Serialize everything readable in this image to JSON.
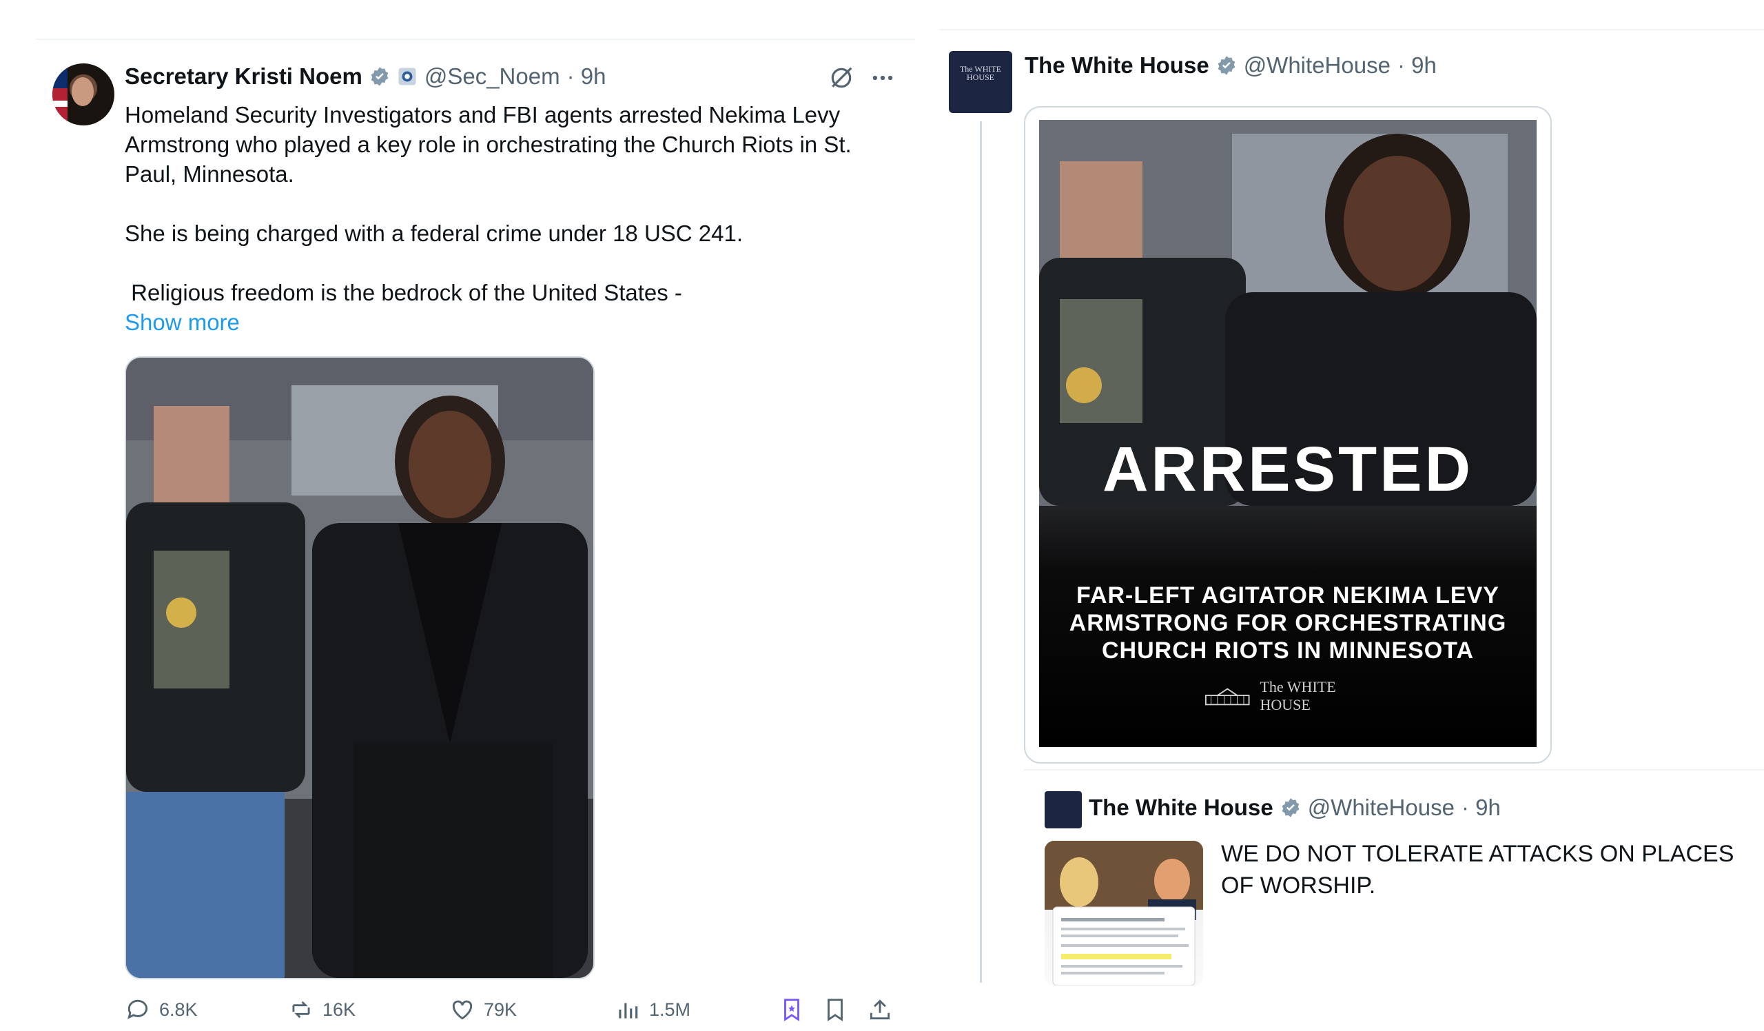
{
  "left_tweet": {
    "author_name": "Secretary Kristi Noem",
    "handle": "@Sec_Noem",
    "time": "· 9h",
    "paragraphs": [
      "Homeland Security Investigators and FBI agents arrested Nekima Levy Armstrong who played a key role in orchestrating the Church Riots in St. Paul, Minnesota.",
      "She is being charged with a federal crime under 18 USC 241.",
      " Religious freedom is the bedrock of the United States -"
    ],
    "show_more": "Show more",
    "metrics": {
      "replies": "6.8K",
      "reposts": "16K",
      "likes": "79K",
      "views": "1.5M"
    },
    "icons": [
      "grok-icon",
      "more-icon",
      "reply-icon",
      "repost-icon",
      "like-icon",
      "views-icon",
      "bookmark-highlight-icon",
      "bookmark-icon",
      "share-icon"
    ]
  },
  "right_tweet": {
    "author_name": "The White House",
    "handle": "@WhiteHouse",
    "time": "· 9h",
    "avatar_text": "The WHITE HOUSE",
    "graphic": {
      "headline": "ARRESTED",
      "subtext_lines": [
        "FAR-LEFT AGITATOR NEKIMA LEVY",
        "ARMSTRONG FOR ORCHESTRATING",
        "CHURCH RIOTS IN MINNESOTA"
      ],
      "footer": "The WHITE HOUSE"
    },
    "quoted": {
      "author_name": "The White House",
      "handle": "@WhiteHouse",
      "time": "· 9h",
      "text": "WE DO NOT TOLERATE ATTACKS ON PLACES OF WORSHIP."
    }
  },
  "colors": {
    "link": "#1d9bf0",
    "secondary_text": "#536471",
    "verified": "#1d9bf0",
    "divider": "#eff3f4"
  }
}
